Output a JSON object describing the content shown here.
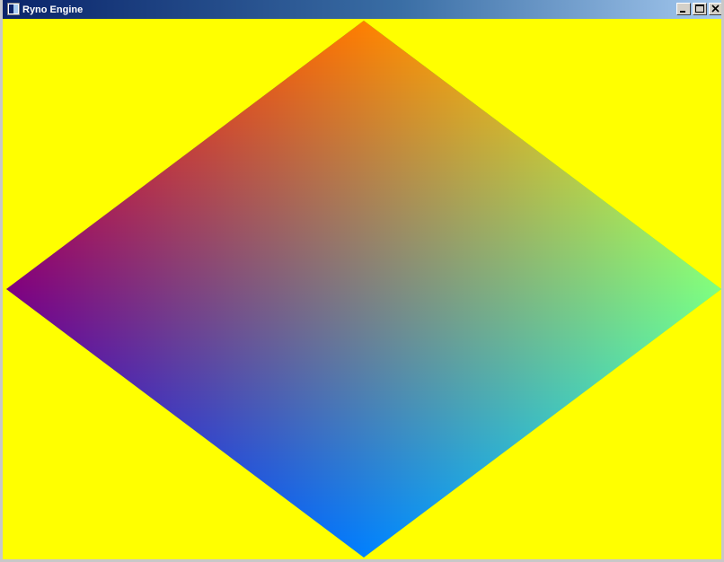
{
  "window": {
    "title": "Ryno Engine",
    "controls": {
      "minimize_icon": "minimize-icon",
      "maximize_icon": "maximize-icon",
      "close_icon": "close-icon"
    }
  },
  "scene": {
    "background_color": "#ffff00",
    "shape": "diamond",
    "vertex_colors": {
      "top": "#ff0000",
      "right": "#00ff00",
      "bottom": "#0000ff",
      "left": "#000000"
    }
  }
}
